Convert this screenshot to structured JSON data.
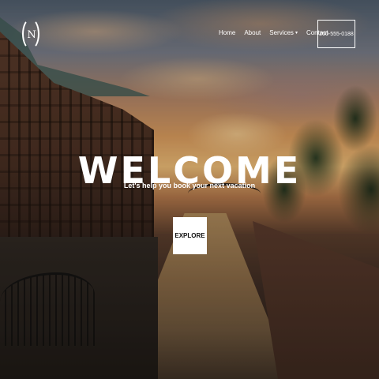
{
  "brand": {
    "logo_letter": "N"
  },
  "nav": {
    "items": [
      {
        "label": "Home"
      },
      {
        "label": "About"
      },
      {
        "label": "Services",
        "icon": "chevron-down-icon"
      },
      {
        "label": "Contact"
      }
    ],
    "phone": "200-555-0188"
  },
  "hero": {
    "title": "WELCOME",
    "subtitle": "Let's help you book your next vacation",
    "cta_label": "EXPLORE"
  }
}
